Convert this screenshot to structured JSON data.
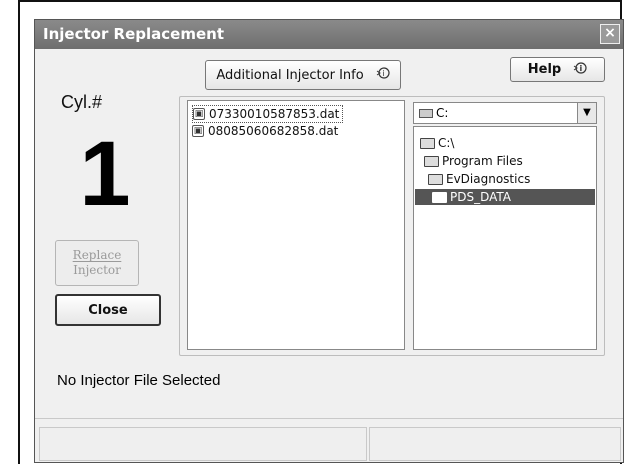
{
  "window": {
    "title": "Injector Replacement",
    "close_glyph": "×"
  },
  "cylinder": {
    "label": "Cyl.#",
    "number": "1"
  },
  "buttons": {
    "additional_info": "Additional Injector Info",
    "help": "Help",
    "replace_line1": "Replace",
    "replace_line2": "Injector",
    "close": "Close",
    "info_icon": "info-pointer-icon"
  },
  "files": [
    {
      "name": "07330010587853.dat",
      "selected": true
    },
    {
      "name": "08085060682858.dat",
      "selected": false
    }
  ],
  "drive": {
    "value": "C:"
  },
  "tree": [
    {
      "label": "C:\\",
      "level": 0,
      "selected": false
    },
    {
      "label": "Program Files",
      "level": 1,
      "selected": false
    },
    {
      "label": "EvDiagnostics",
      "level": 2,
      "selected": false
    },
    {
      "label": "PDS_DATA",
      "level": 3,
      "selected": true
    }
  ],
  "status": {
    "message": "No Injector File Selected"
  },
  "colors": {
    "titlebar": "#7a7a7a",
    "selection": "#555555"
  }
}
